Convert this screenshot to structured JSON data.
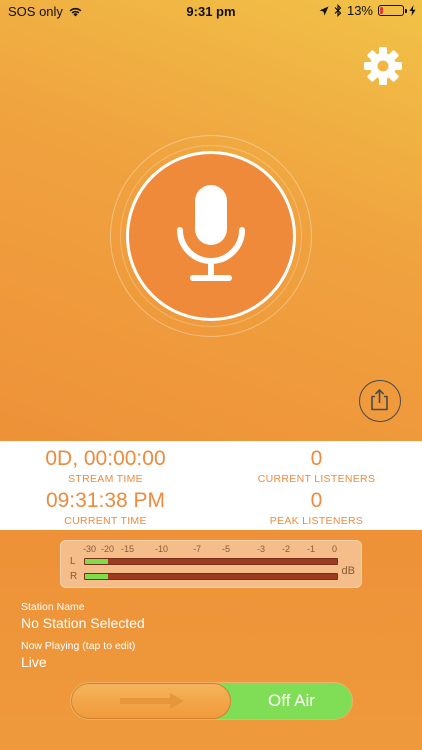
{
  "status_bar": {
    "carrier": "SOS only",
    "time": "9:31 pm",
    "battery_percent": "13%",
    "battery_level": 0.13
  },
  "controls": {
    "settings_icon": "gear-icon",
    "mic_icon": "microphone-icon",
    "share_icon": "share-icon"
  },
  "stats": {
    "stream_time": {
      "value": "0D, 00:00:00",
      "label": "STREAM TIME"
    },
    "current_listeners": {
      "value": "0",
      "label": "CURRENT LISTENERS"
    },
    "current_time": {
      "value": "09:31:38 PM",
      "label": "CURRENT TIME"
    },
    "peak_listeners": {
      "value": "0",
      "label": "PEAK LISTENERS"
    }
  },
  "meter": {
    "scale": [
      "-30",
      "-20",
      "-15",
      "-10",
      "-7",
      "-5",
      "-3",
      "-2",
      "-1",
      "0"
    ],
    "left_label": "L",
    "right_label": "R",
    "unit": "dB",
    "left_level": 0.09,
    "right_level": 0.09
  },
  "station": {
    "name_label": "Station Name",
    "name_value": "No Station Selected",
    "now_playing_label": "Now Playing (tap to edit)",
    "now_playing_value": "Live"
  },
  "slider": {
    "label": "Off Air"
  },
  "colors": {
    "accent": "#ec8b3d",
    "off_air_green": "#7fde55",
    "meter_green": "#7fdd4a"
  }
}
